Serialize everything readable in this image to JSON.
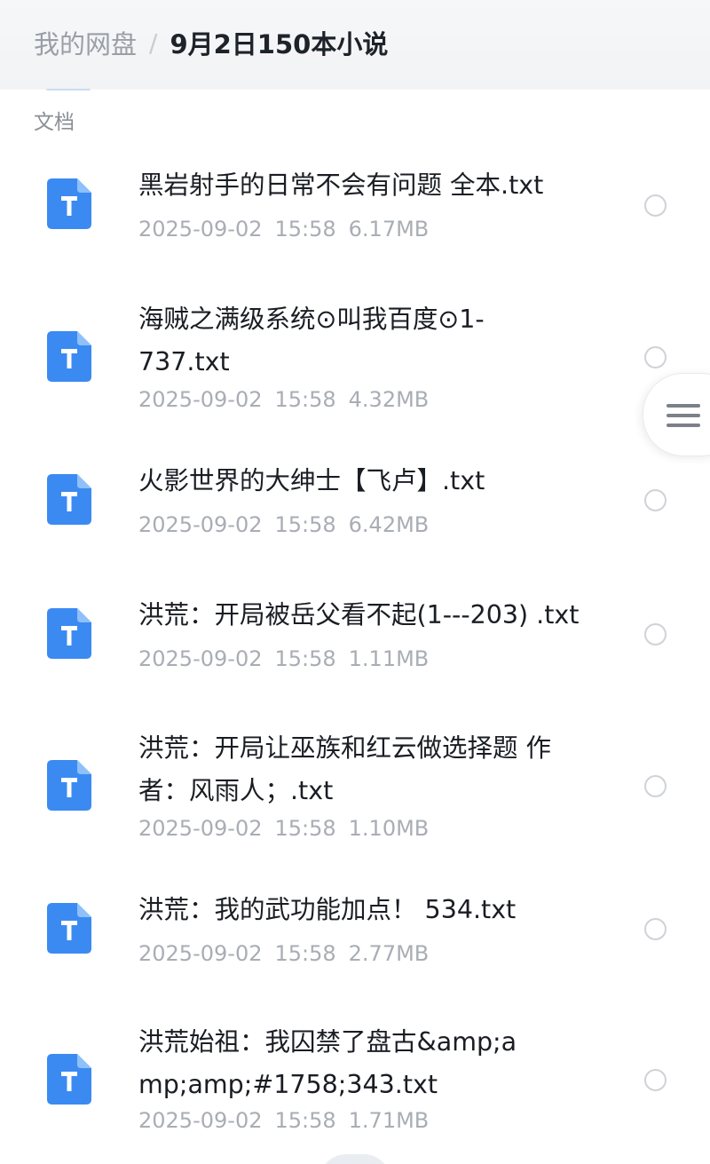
{
  "header": {
    "root": "我的网盘",
    "separator": "/",
    "current": "9月2日150本小说"
  },
  "section": {
    "label": "文档"
  },
  "files": [
    {
      "name": "黑岩射手的日常不会有问题 全本.txt",
      "date": "2025-09-02",
      "time": "15:58",
      "size": "6.17MB",
      "icon": "txt-file-icon"
    },
    {
      "name": "海贼之满级系统⊙叫我百度⊙1-737.txt",
      "date": "2025-09-02",
      "time": "15:58",
      "size": "4.32MB",
      "icon": "txt-file-icon"
    },
    {
      "name": "火影世界的大绅士【飞卢】.txt",
      "date": "2025-09-02",
      "time": "15:58",
      "size": "6.42MB",
      "icon": "txt-file-icon"
    },
    {
      "name": "洪荒：开局被岳父看不起(1---203) .txt",
      "date": "2025-09-02",
      "time": "15:58",
      "size": "1.11MB",
      "icon": "txt-file-icon"
    },
    {
      "name": "洪荒：开局让巫族和红云做选择题 作者：风雨人；.txt",
      "date": "2025-09-02",
      "time": "15:58",
      "size": "1.10MB",
      "icon": "txt-file-icon"
    },
    {
      "name": "洪荒：我的武功能加点！ 534.txt",
      "date": "2025-09-02",
      "time": "15:58",
      "size": "2.77MB",
      "icon": "txt-file-icon"
    },
    {
      "name": "洪荒始祖：我囚禁了盘古&amp;amp;amp;#1758;343.txt",
      "date": "2025-09-02",
      "time": "15:58",
      "size": "1.71MB",
      "icon": "txt-file-icon"
    }
  ],
  "colors": {
    "icon_blue": "#3b8af2",
    "title_text": "#1a1d23",
    "meta_text": "#a9adb4"
  },
  "floating_button": {
    "icon": "menu-icon"
  }
}
